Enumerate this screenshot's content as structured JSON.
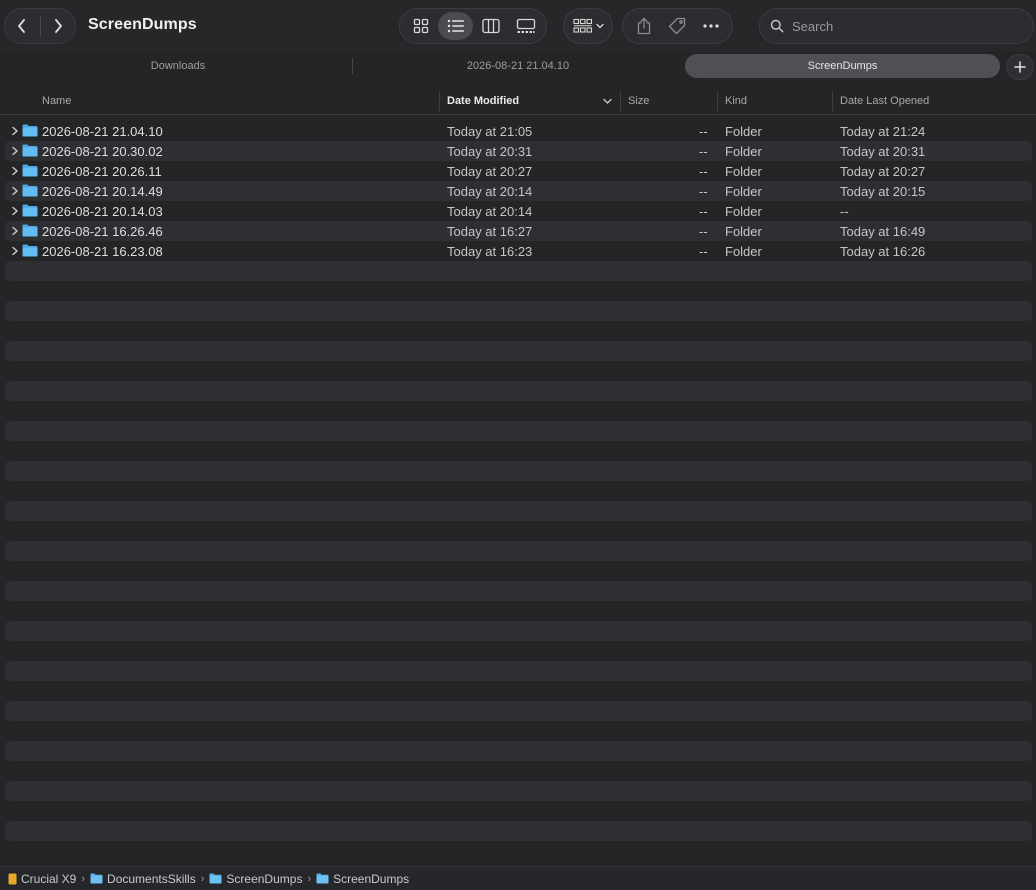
{
  "window": {
    "title": "ScreenDumps"
  },
  "toolbar": {
    "back_icon": "chevron-left-icon",
    "forward_icon": "chevron-right-icon",
    "view_modes": [
      "icon-view",
      "list-view",
      "column-view",
      "gallery-view"
    ],
    "active_view": "list-view",
    "group_icon": "group-by-icon",
    "actions": [
      "share-icon",
      "tag-icon",
      "more-icon"
    ],
    "search_placeholder": "Search"
  },
  "tabs": [
    {
      "label": "Downloads",
      "active": false
    },
    {
      "label": "2026-08-21 21.04.10",
      "active": false
    },
    {
      "label": "ScreenDumps",
      "active": true
    }
  ],
  "columns": {
    "name": "Name",
    "date_modified": "Date Modified",
    "size": "Size",
    "kind": "Kind",
    "date_last_opened": "Date Last Opened",
    "sorted_by": "date_modified",
    "sort_order": "descending"
  },
  "rows": [
    {
      "name": "2026-08-21 21.04.10",
      "modified": "Today at 21:05",
      "size": "--",
      "kind": "Folder",
      "opened": "Today at 21:24"
    },
    {
      "name": "2026-08-21 20.30.02",
      "modified": "Today at 20:31",
      "size": "--",
      "kind": "Folder",
      "opened": "Today at 20:31"
    },
    {
      "name": "2026-08-21 20.26.11",
      "modified": "Today at 20:27",
      "size": "--",
      "kind": "Folder",
      "opened": "Today at 20:27"
    },
    {
      "name": "2026-08-21 20.14.49",
      "modified": "Today at 20:14",
      "size": "--",
      "kind": "Folder",
      "opened": "Today at 20:15"
    },
    {
      "name": "2026-08-21 20.14.03",
      "modified": "Today at 20:14",
      "size": "--",
      "kind": "Folder",
      "opened": "--"
    },
    {
      "name": "2026-08-21 16.26.46",
      "modified": "Today at 16:27",
      "size": "--",
      "kind": "Folder",
      "opened": "Today at 16:49"
    },
    {
      "name": "2026-08-21 16.23.08",
      "modified": "Today at 16:23",
      "size": "--",
      "kind": "Folder",
      "opened": "Today at 16:26"
    }
  ],
  "pathbar": [
    {
      "label": "Crucial X9",
      "icon": "drive-icon"
    },
    {
      "label": "DocumentsSkills",
      "icon": "folder-icon"
    },
    {
      "label": "ScreenDumps",
      "icon": "folder-icon"
    },
    {
      "label": "ScreenDumps",
      "icon": "folder-icon"
    }
  ],
  "colors": {
    "window_bg": "#232527",
    "stripe": "#2d2f32",
    "folder_blue": "#5ab4ec",
    "drive_yellow": "#e8a92a",
    "active_tab": "#4e5054"
  }
}
